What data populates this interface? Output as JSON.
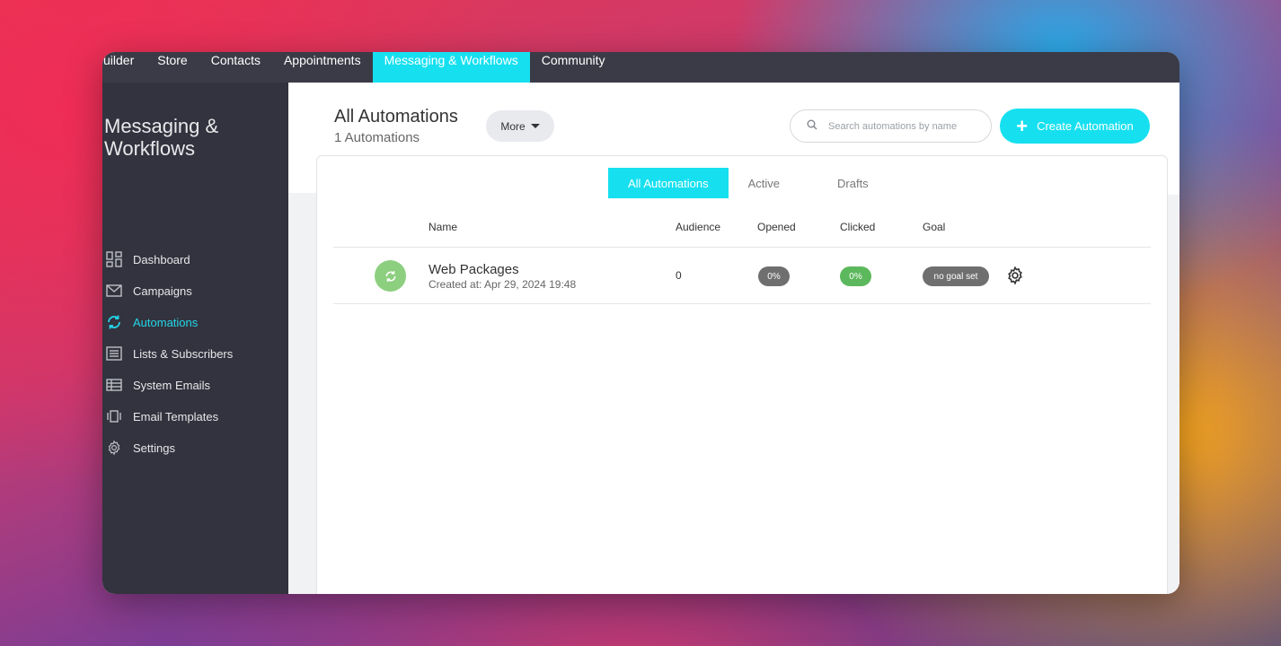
{
  "topnav": {
    "items": [
      {
        "label": "uilder"
      },
      {
        "label": "Store"
      },
      {
        "label": "Contacts"
      },
      {
        "label": "Appointments"
      },
      {
        "label": "Messaging & Workflows"
      },
      {
        "label": "Community"
      }
    ],
    "active_index": 4
  },
  "sidebar": {
    "title": "Messaging & Workflows",
    "items": [
      {
        "label": "Dashboard",
        "icon": "dashboard-icon"
      },
      {
        "label": "Campaigns",
        "icon": "envelope-icon"
      },
      {
        "label": "Automations",
        "icon": "refresh-icon"
      },
      {
        "label": "Lists & Subscribers",
        "icon": "list-icon"
      },
      {
        "label": "System Emails",
        "icon": "table-icon"
      },
      {
        "label": "Email Templates",
        "icon": "template-icon"
      },
      {
        "label": "Settings",
        "icon": "gear-icon"
      }
    ],
    "active_index": 2
  },
  "header": {
    "title": "All Automations",
    "subtitle": "1 Automations",
    "more_label": "More",
    "search_placeholder": "Search automations by name",
    "create_label": "Create Automation"
  },
  "tabs": [
    {
      "label": "All Automations"
    },
    {
      "label": "Active"
    },
    {
      "label": "Drafts"
    }
  ],
  "table": {
    "columns": [
      "Name",
      "Audience",
      "Opened",
      "Clicked",
      "Goal"
    ],
    "rows": [
      {
        "name": "Web Packages",
        "created": "Created at: Apr 29, 2024 19:48",
        "audience": "0",
        "opened": "0%",
        "clicked": "0%",
        "goal": "no goal set"
      }
    ]
  },
  "colors": {
    "accent": "#16e0f0",
    "sidebar_bg": "#32333e",
    "topnav_bg": "#3a3b46",
    "clicked_green": "#5cb85c",
    "row_icon_green": "#8ccf7f"
  }
}
